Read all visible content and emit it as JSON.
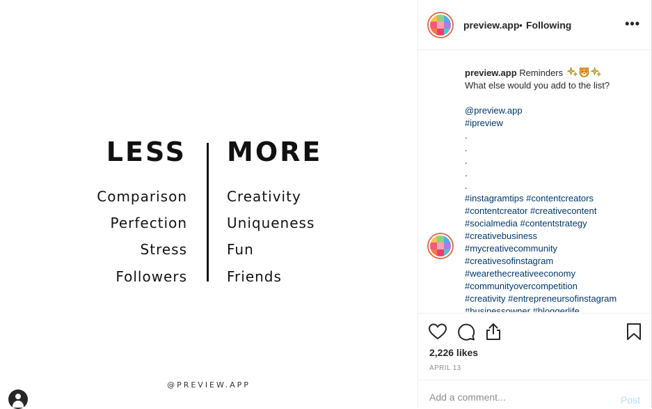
{
  "post_image": {
    "less_heading": "LESS",
    "more_heading": "MORE",
    "less_items": [
      "Comparison",
      "Perfection",
      "Stress",
      "Followers"
    ],
    "more_items": [
      "Creativity",
      "Uniqueness",
      "Fun",
      "Friends"
    ],
    "watermark": "@PREVIEW.APP"
  },
  "header": {
    "username": "preview.app",
    "separator": "•",
    "follow_status": "Following",
    "more_icon": "more-options-icon",
    "more_label": "•••"
  },
  "caption": {
    "username": "preview.app",
    "text_line1": "Reminders",
    "emojis": [
      "sparkles",
      "tiger-face",
      "sparkles"
    ],
    "text_line2": "What else would you add to the list?",
    "mention": "@preview.app",
    "hashtag1": "#ipreview",
    "dots": [
      ".",
      ".",
      ".",
      ".",
      "."
    ],
    "hashtag_lines": [
      "#instagramtips #contentcreators",
      "#contentcreator #creativecontent",
      "#socialmedia #contentstrategy",
      "#creativebusiness",
      "#mycreativecommunity",
      "#creativesofinstagram",
      "#wearethecreativeeconomy",
      "#communityovercompetition",
      "#creativity #entrepreneursofinstagram",
      "#businessowner #bloggerlife"
    ]
  },
  "actions": {
    "icons": [
      "heart-icon",
      "comment-icon",
      "share-icon",
      "bookmark-icon"
    ],
    "likes": "2,226 likes",
    "date": "APRIL 13"
  },
  "comment": {
    "placeholder": "Add a comment...",
    "post_label": "Post"
  },
  "colors": {
    "avatar_ring": "#e0704c",
    "link": "#00376b",
    "post_disabled": "#b2dffc",
    "secondary_text": "#8e8e8e"
  }
}
